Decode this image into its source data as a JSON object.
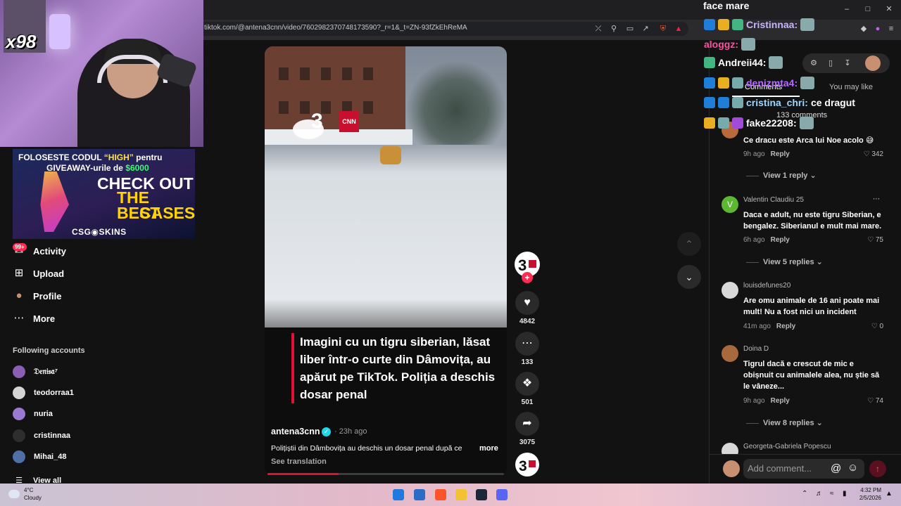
{
  "browser": {
    "url": "tiktok.com/@antena3cnn/video/7602982370748173590?_r=1&_t=ZN-93fZkEhReMA"
  },
  "stream": {
    "overlay_counter": "x98"
  },
  "ad": {
    "line1_pre": "FOLOSESTE CODUL ",
    "line1_code": "“HIGH”",
    "line1_post": " pentru",
    "line2_pre": "GIVEAWAY-urile de ",
    "line2_amount": "$6000",
    "check_out": "CHECK OUT",
    "the_best": "THE BEST",
    "cases": "CASES",
    "brand": "CSG◉SKINS"
  },
  "sidebar": {
    "activity_badge": "99+",
    "nav": [
      {
        "label": "Activity",
        "icon": "✉"
      },
      {
        "label": "Upload",
        "icon": "⊞"
      },
      {
        "label": "Profile",
        "icon": "●"
      },
      {
        "label": "More",
        "icon": "⋯"
      }
    ],
    "following_title": "Following accounts",
    "accounts": [
      {
        "name": "𝔇𝔢𝔫𝔦𝔰𝔞⁷",
        "color": "#8a5fb5"
      },
      {
        "name": "teodorraa1",
        "color": "#d4d4d4"
      },
      {
        "name": "nuria",
        "color": "#9a7ad0"
      },
      {
        "name": "cristinnaa",
        "color": "#2e2e2e"
      },
      {
        "name": "Mihai_48",
        "color": "#4f6fa8"
      }
    ],
    "view_all": "View all"
  },
  "video": {
    "caption": "Imagini cu un tigru siberian, lăsat liber într-o curte din Dâmovița, au apărut pe TikTok. Poliția a deschis dosar penal",
    "cnn_label": "CNN",
    "author": "antena3cnn",
    "verified_icon": "✓",
    "time": "· 23h ago",
    "description": "Polițiștii din Dâmbovița au deschis un dosar penal după ce",
    "more": "more",
    "see_translation": "See translation",
    "accent": "#e0122f"
  },
  "actions": {
    "likes": "4842",
    "comments": "133",
    "saves": "501",
    "shares": "3075"
  },
  "chat": {
    "title": "face mare",
    "lines": [
      {
        "user": "Cristinnaa:",
        "msg": "",
        "color": "#c9b3ff"
      },
      {
        "user": "aloggz:",
        "msg": "",
        "color": "#ff4fa3"
      },
      {
        "user": "Andreii44:",
        "msg": "",
        "color": "#ffffff"
      },
      {
        "user": "denizmta4:",
        "msg": "",
        "color": "#b46bff"
      },
      {
        "user": "cristina_chri:",
        "msg": "ce dragut",
        "color": "#9fd6ff"
      },
      {
        "user": "fake22208:",
        "msg": "",
        "color": "#ffffff"
      }
    ]
  },
  "comments_panel": {
    "tab_comments": "Comments",
    "tab_you_may_like": "You may like",
    "count": "133 comments",
    "items": [
      {
        "user": "",
        "text": "Ce dracu este Arca lui Noe acolo 😅",
        "time": "9h ago",
        "reply": "Reply",
        "likes": "342",
        "view_replies": "View 1 reply",
        "avatar_color": "#b86a3a"
      },
      {
        "user": "Valentin Claudiu 25",
        "text": "Daca e adult, nu este tigru Siberian, e bengalez. Siberianul e mult mai mare.",
        "time": "6h ago",
        "reply": "Reply",
        "likes": "75",
        "view_replies": "View 5 replies",
        "avatar_color": "#5bb830",
        "avatar_letter": "V"
      },
      {
        "user": "louisdefunes20",
        "text": "Are omu animale de 16 ani poate mai mult! Nu a fost nici un incident",
        "time": "41m ago",
        "reply": "Reply",
        "likes": "0",
        "view_replies": "",
        "avatar_color": "#d8d8d8"
      },
      {
        "user": "Doina D",
        "text": "Tigrul dacă e crescut de mic e obișnuit cu animalele alea, nu știe să le vâneze...",
        "time": "9h ago",
        "reply": "Reply",
        "likes": "74",
        "view_replies": "View 8 replies",
        "avatar_color": "#a86a3c"
      },
      {
        "user": "Georgeta-Gabriela Popescu",
        "text": "",
        "time": "",
        "reply": "",
        "likes": "",
        "view_replies": "",
        "avatar_color": "#d8d8d8"
      }
    ],
    "add_placeholder": "Add comment..."
  },
  "taskbar": {
    "temp": "4°C",
    "condition": "Cloudy",
    "time": "4:32 PM",
    "date": "2/5/2026"
  }
}
